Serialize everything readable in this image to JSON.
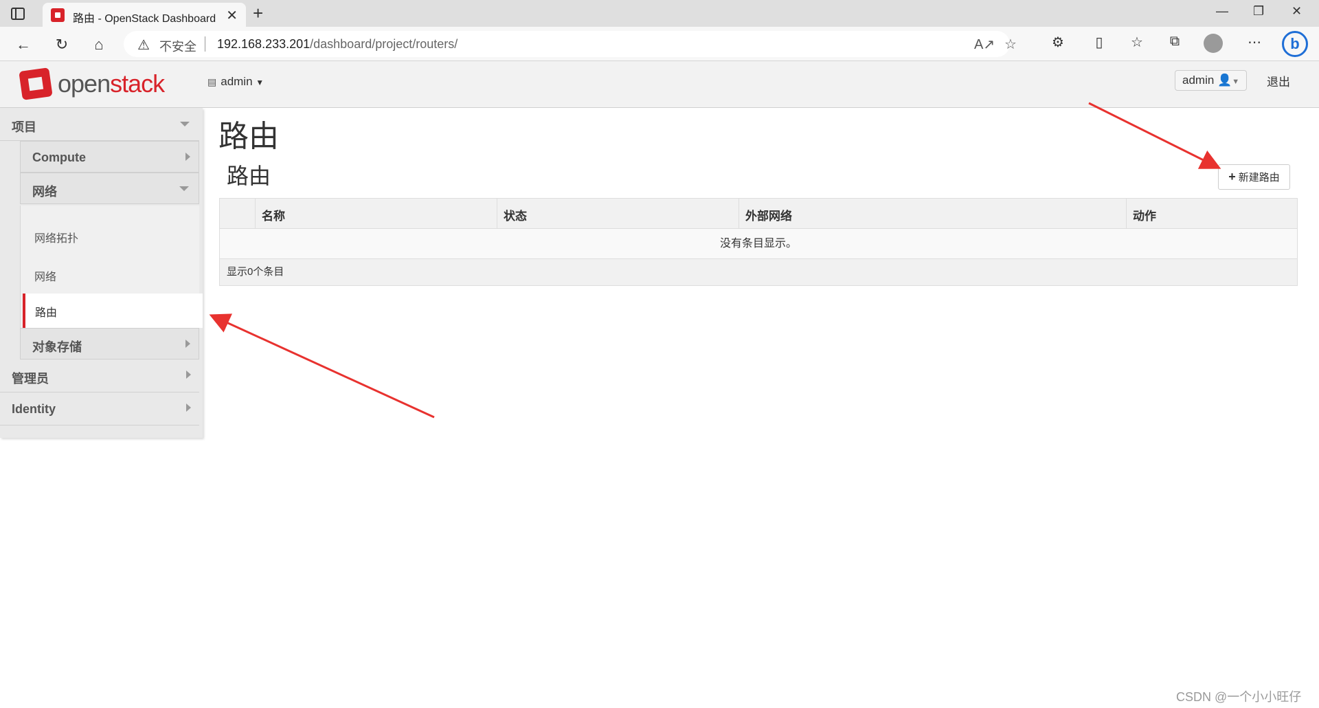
{
  "browser": {
    "tab_title": "路由 - OpenStack Dashboard",
    "insecure_label": "不安全",
    "url_host": "192.168.233.201",
    "url_path": "/dashboard/project/routers/"
  },
  "header": {
    "logo_open": "open",
    "logo_stack": "stack",
    "project_selector": "admin",
    "user_menu": "admin",
    "logout": "退出"
  },
  "sidebar": {
    "project": "项目",
    "compute": "Compute",
    "network": "网络",
    "network_items": [
      "网络拓扑",
      "网络",
      "路由"
    ],
    "object_storage": "对象存储",
    "admin": "管理员",
    "identity": "Identity"
  },
  "main": {
    "page_title": "路由",
    "section_title": "路由",
    "create_button": "新建路由",
    "table": {
      "columns": [
        "名称",
        "状态",
        "外部网络",
        "动作"
      ],
      "empty_message": "没有条目显示。",
      "footer": "显示0个条目"
    }
  },
  "watermark": "CSDN @一个小小旺仔",
  "colors": {
    "accent": "#d8232a",
    "annotation_arrow": "#e8322f"
  }
}
